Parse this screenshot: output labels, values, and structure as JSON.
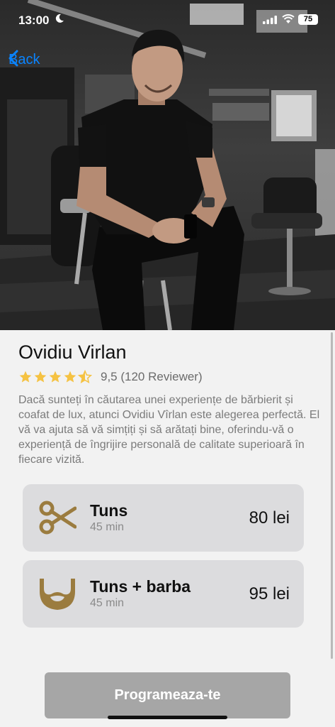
{
  "status_bar": {
    "time": "13:00",
    "battery": "75"
  },
  "nav": {
    "back_label": "Back"
  },
  "barber": {
    "name": "Ovidiu Virlan",
    "rating_stars": 4.5,
    "rating_text": "9,5 (120 Reviewer)",
    "description": "Dacă sunteți în căutarea unei experiențe de bărbierit și coafat de lux, atunci Ovidiu Vîrlan este alegerea perfectă. El vă va ajuta să vă simțiți și să arătați bine, oferindu-vă o experiență de îngrijire personală de calitate superioară în fiecare vizită."
  },
  "services": [
    {
      "icon": "scissors-icon",
      "title": "Tuns",
      "duration": "45 min",
      "price": "80 lei"
    },
    {
      "icon": "beard-icon",
      "title": "Tuns + barba",
      "duration": "45 min",
      "price": "95 lei"
    }
  ],
  "cta": {
    "label": "Programeaza-te"
  },
  "colors": {
    "accent": "#0a84ff",
    "star": "#f5c242",
    "icon_gold": "#9b7c3f",
    "card": "#dcdcde",
    "button": "#a6a6a6"
  }
}
